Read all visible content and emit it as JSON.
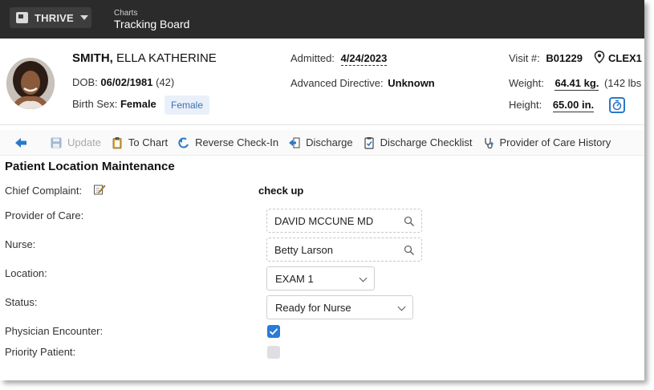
{
  "app": {
    "name": "THRIVE"
  },
  "breadcrumb": {
    "parent": "Charts",
    "current": "Tracking Board"
  },
  "patient": {
    "last_name": "SMITH,",
    "first_names": "ELLA KATHERINE",
    "dob_label": "DOB:",
    "dob": "06/02/1981",
    "age": "(42)",
    "birth_sex_label": "Birth Sex:",
    "birth_sex": "Female",
    "gender_tag": "Female",
    "admitted_label": "Admitted:",
    "admitted": "4/24/2023",
    "directive_label": "Advanced Directive:",
    "directive": "Unknown",
    "visit_label": "Visit #:",
    "visit": "B01229",
    "location_code": "CLEX1",
    "weight_label": "Weight:",
    "weight": "64.41 kg.",
    "weight_alt": "(142 lbs",
    "height_label": "Height:",
    "height": "65.00 in."
  },
  "toolbar": {
    "update": "Update",
    "to_chart": "To Chart",
    "reverse_checkin": "Reverse Check-In",
    "discharge": "Discharge",
    "discharge_checklist": "Discharge Checklist",
    "provider_history": "Provider of Care History"
  },
  "form": {
    "title": "Patient Location Maintenance",
    "chief_complaint_label": "Chief Complaint:",
    "chief_complaint": "check up",
    "provider_label": "Provider of Care:",
    "provider": "DAVID MCCUNE MD",
    "nurse_label": "Nurse:",
    "nurse": "Betty Larson",
    "location_label": "Location:",
    "location": "EXAM 1",
    "status_label": "Status:",
    "status": "Ready for Nurse",
    "physician_encounter_label": "Physician Encounter:",
    "physician_encounter": true,
    "priority_label": "Priority Patient:",
    "priority": false
  },
  "colors": {
    "topbar": "#2b2b2b",
    "accent": "#2a7ad8",
    "tag_bg": "#eaf0f9"
  }
}
